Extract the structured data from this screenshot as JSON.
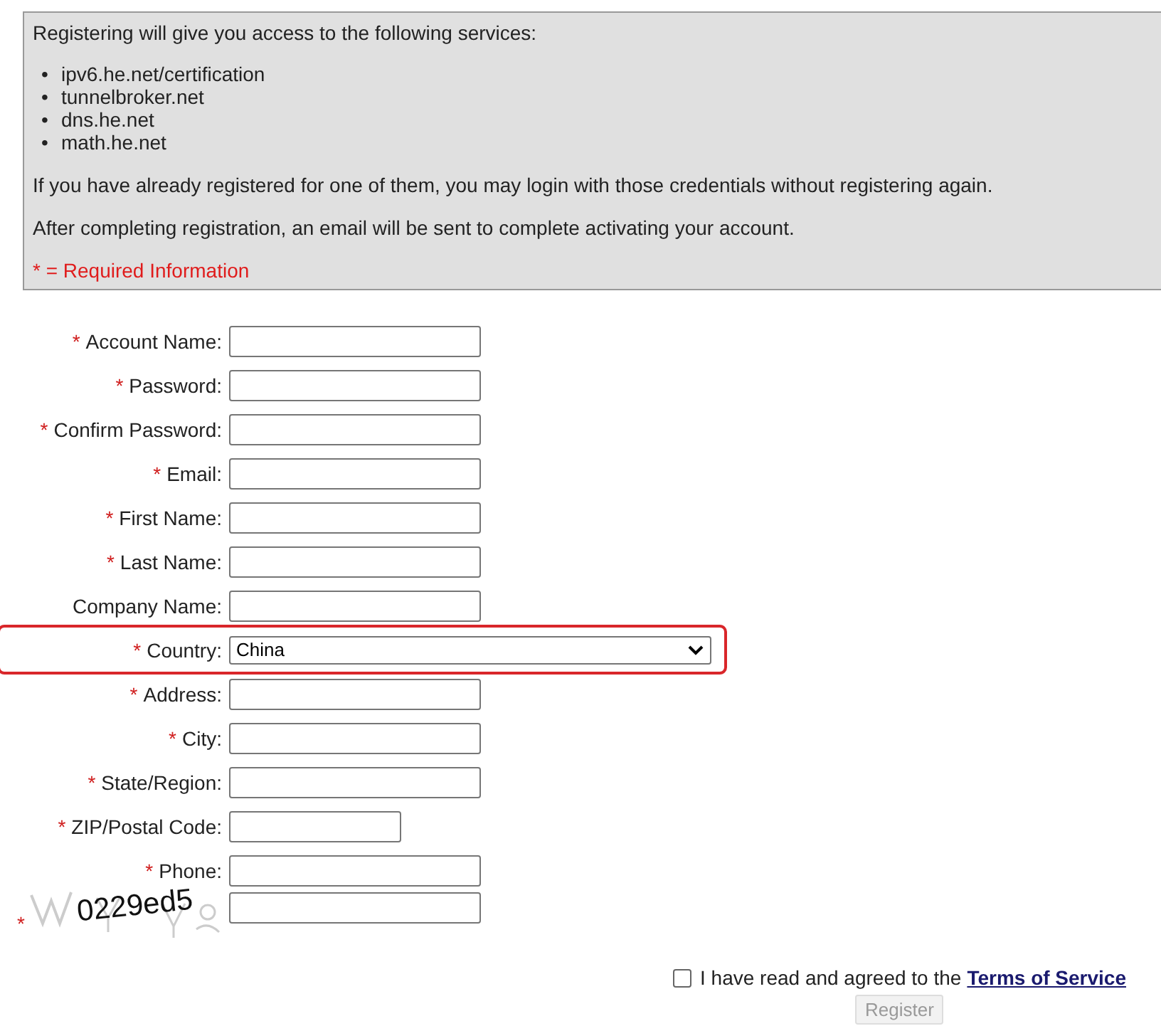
{
  "info": {
    "intro": "Registering will give you access to the following services:",
    "services": [
      {
        "bullet": "•",
        "text": "ipv6.he.net/certification"
      },
      {
        "bullet": "•",
        "text": "tunnelbroker.net"
      },
      {
        "bullet": "•",
        "text": "dns.he.net"
      },
      {
        "bullet": "•",
        "text": "math.he.net"
      }
    ],
    "paragraphs": [
      "If you have already registered for one of them, you may login with those credentials without registering again.",
      "After completing registration, an email will be sent to complete activating your account."
    ],
    "required_note": "* = Required Information"
  },
  "fields": [
    {
      "label": "Account Name:",
      "required_mark": "*",
      "kind": "text",
      "highlighted": false
    },
    {
      "label": "Password:",
      "required_mark": "*",
      "kind": "text",
      "highlighted": false
    },
    {
      "label": "Confirm Password:",
      "required_mark": "*",
      "kind": "text",
      "highlighted": false
    },
    {
      "label": "Email:",
      "required_mark": "*",
      "kind": "text",
      "highlighted": false
    },
    {
      "label": "First Name:",
      "required_mark": "*",
      "kind": "text",
      "highlighted": false
    },
    {
      "label": "Last Name:",
      "required_mark": "*",
      "kind": "text",
      "highlighted": false
    },
    {
      "label": "Company Name:",
      "kind": "text",
      "highlighted": false
    },
    {
      "label": "Country:",
      "required_mark": "*",
      "kind": "select",
      "value": "China",
      "highlighted": true
    },
    {
      "label": "Address:",
      "required_mark": "*",
      "kind": "text",
      "highlighted": false
    },
    {
      "label": "City:",
      "required_mark": "*",
      "kind": "text",
      "highlighted": false
    },
    {
      "label": "State/Region:",
      "required_mark": "*",
      "kind": "text",
      "highlighted": false
    },
    {
      "label": "ZIP/Postal Code:",
      "required_mark": "*",
      "kind": "short",
      "highlighted": false
    },
    {
      "label": "Phone:",
      "required_mark": "*",
      "kind": "text",
      "highlighted": false
    }
  ],
  "captcha": {
    "required_mark": "*",
    "code": "0229ed5"
  },
  "terms": {
    "checked": false,
    "text": "I have read and agreed to the",
    "link": "Terms of Service"
  },
  "register_button": {
    "label": "Register",
    "disabled": true
  }
}
